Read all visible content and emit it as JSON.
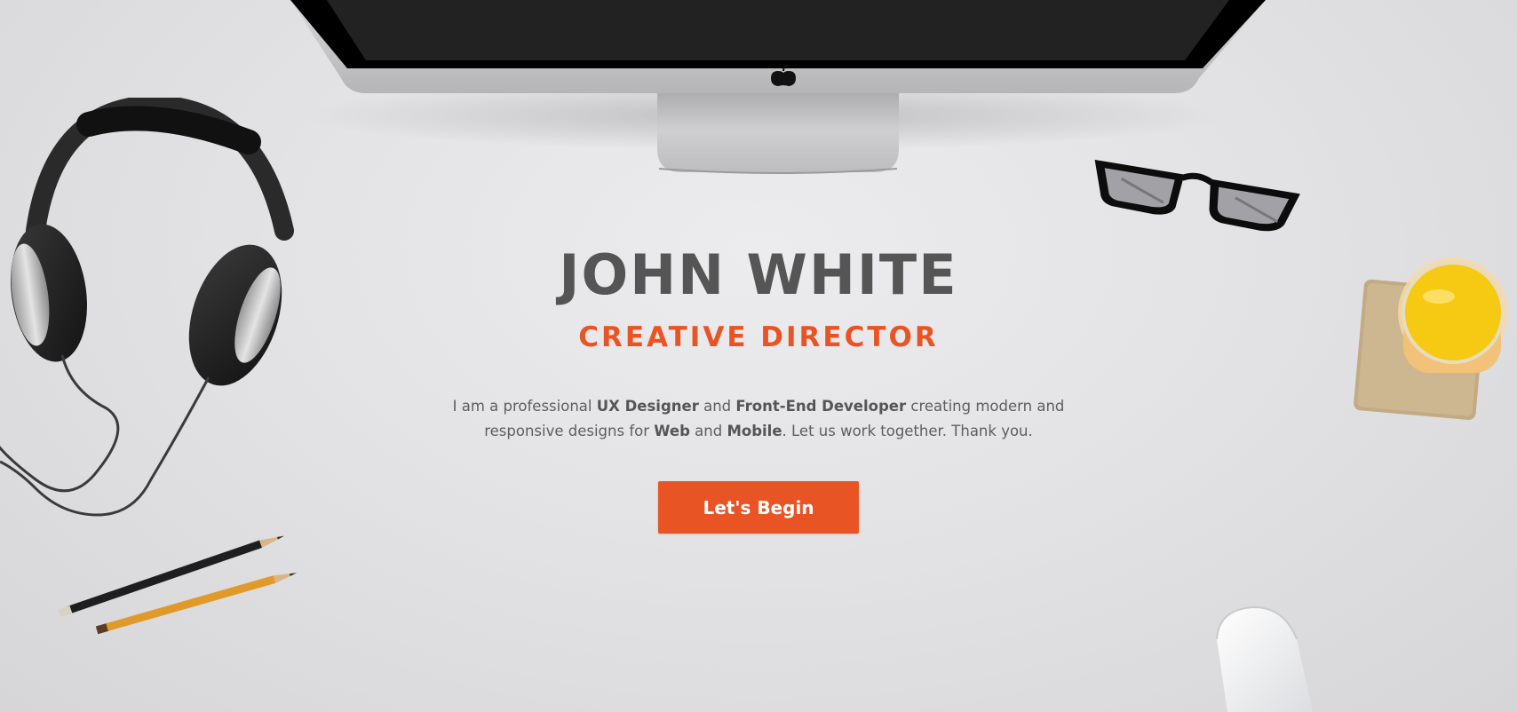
{
  "hero": {
    "name": "JOHN WHITE",
    "title": "CREATIVE DIRECTOR",
    "description": {
      "part1": "I am a professional ",
      "skill1": "UX Designer",
      "part2": " and ",
      "skill2": "Front-End Developer",
      "part3": " creating modern and responsive designs for ",
      "platform1": "Web",
      "part4": " and ",
      "platform2": "Mobile",
      "part5": ". Let us work together. Thank you."
    },
    "cta_label": "Let's Begin"
  },
  "colors": {
    "accent": "#e95425",
    "heading": "#555555",
    "body_text": "#5e5e5e",
    "background": "#e3e3e5"
  },
  "decor": {
    "monitor": "imac-monitor-illustration",
    "logo": "apple-logo-icon",
    "headphones": "headphones-illustration",
    "pencils": "pencils-illustration",
    "glasses": "eyeglasses-illustration",
    "juice": "orange-juice-glass-illustration",
    "mouse": "mouse-illustration"
  }
}
